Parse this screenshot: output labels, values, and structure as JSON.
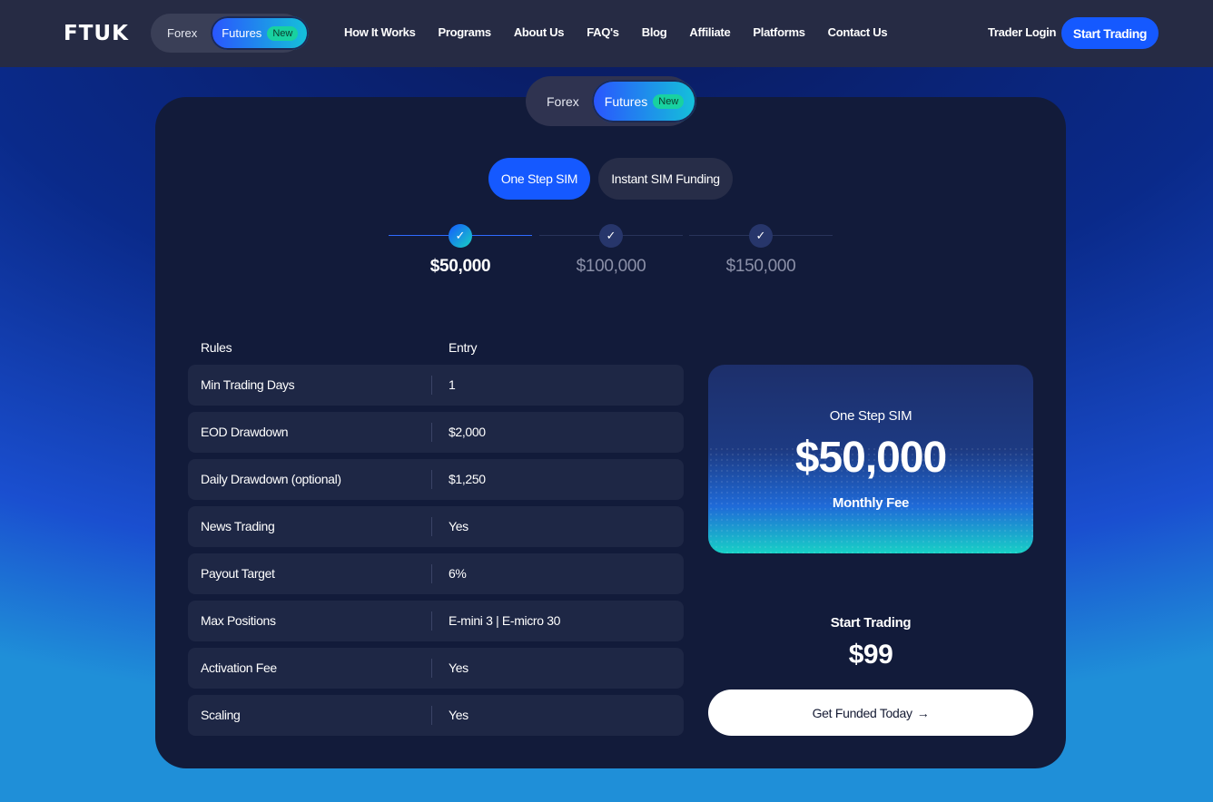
{
  "header": {
    "logo": "FTUK",
    "segment": {
      "forex": "Forex",
      "futures": "Futures",
      "badge": "New"
    },
    "nav": [
      "How It Works",
      "Programs",
      "About Us",
      "FAQ's",
      "Blog",
      "Affiliate",
      "Platforms",
      "Contact Us"
    ],
    "trader_login": "Trader Login",
    "start_trading": "Start Trading"
  },
  "card": {
    "segment": {
      "forex": "Forex",
      "futures": "Futures",
      "badge": "New"
    },
    "tabs": {
      "active": "One Step SIM",
      "inactive": "Instant SIM Funding"
    },
    "steps": [
      {
        "amount": "$50,000",
        "check": "✓"
      },
      {
        "amount": "$100,000",
        "check": "✓"
      },
      {
        "amount": "$150,000",
        "check": "✓"
      }
    ],
    "rules_header": "Rules",
    "entry_header": "Entry",
    "rules": [
      {
        "name": "Min Trading Days",
        "value": "1"
      },
      {
        "name": "EOD Drawdown",
        "value": "$2,000"
      },
      {
        "name": "Daily Drawdown (optional)",
        "value": "$1,250"
      },
      {
        "name": "News Trading",
        "value": "Yes"
      },
      {
        "name": "Payout Target",
        "value": "6%"
      },
      {
        "name": "Max Positions",
        "value": "E-mini 3 | E-micro 30"
      },
      {
        "name": "Activation Fee",
        "value": "Yes"
      },
      {
        "name": "Scaling",
        "value": "Yes"
      }
    ],
    "price_panel": {
      "label": "One Step SIM",
      "amount": "$50,000",
      "sub": "Monthly Fee"
    },
    "start_label": "Start Trading",
    "start_price": "$99",
    "cta": "Get Funded Today",
    "cta_arrow": "→"
  }
}
